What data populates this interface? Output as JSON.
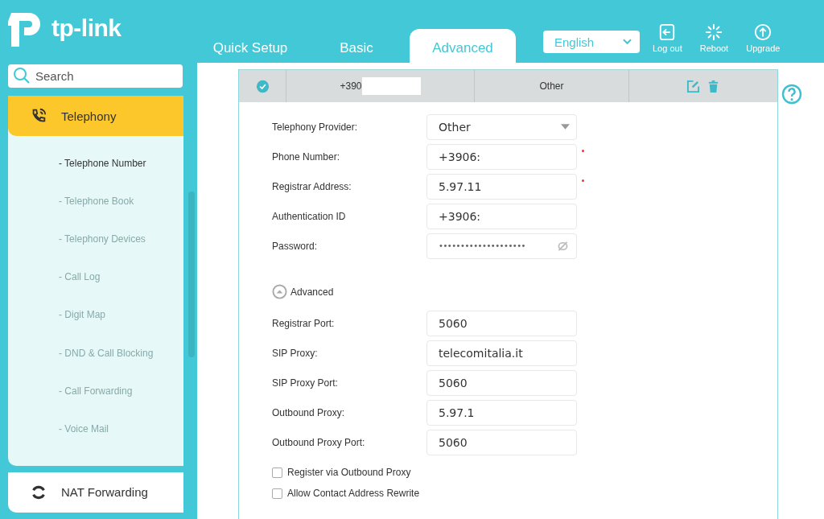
{
  "header": {
    "logo": "tp-link",
    "tabs": [
      {
        "label": "Quick Setup",
        "selected": false
      },
      {
        "label": "Basic",
        "selected": false
      },
      {
        "label": "Advanced",
        "selected": true
      }
    ],
    "language": "English",
    "actions": [
      {
        "kind": "logout",
        "label": "Log out"
      },
      {
        "kind": "reboot",
        "label": "Reboot"
      },
      {
        "kind": "upgrade",
        "label": "Upgrade"
      }
    ]
  },
  "sidebar": {
    "search": {
      "placeholder": "Search"
    },
    "items": [
      {
        "kind": "phone",
        "label": "Telephony",
        "selected": true,
        "expanded": true,
        "children": [
          {
            "label": "- Telephone Number",
            "selected": true
          },
          {
            "label": "- Telephone Book",
            "selected": false
          },
          {
            "label": "- Telephony Devices",
            "selected": false
          },
          {
            "label": "- Call Log",
            "selected": false
          },
          {
            "label": "- Digit Map",
            "selected": false
          },
          {
            "label": "- DND & Call Blocking",
            "selected": false
          },
          {
            "label": "- Call Forwarding",
            "selected": false
          },
          {
            "label": "- Voice Mail",
            "selected": false
          }
        ]
      },
      {
        "kind": "nat",
        "label": "NAT Forwarding",
        "selected": false,
        "expanded": false
      }
    ]
  },
  "table": {
    "row": {
      "checked": true,
      "number": "+390",
      "redacted": true,
      "provider": "Other"
    }
  },
  "form": {
    "fields": [
      {
        "kind": "select",
        "label": "Telephony Provider:",
        "value": "Other",
        "required": false
      },
      {
        "kind": "text",
        "label": "Phone Number:",
        "value": "+3906:",
        "required": true
      },
      {
        "kind": "text",
        "label": "Registrar Address:",
        "value": "5.97.11",
        "required": true
      },
      {
        "kind": "text",
        "label": "Authentication ID",
        "value": "+3906:",
        "required": false
      },
      {
        "kind": "password",
        "label": "Password:",
        "value": "••••••••••••••••••••",
        "required": false
      }
    ],
    "advanced": {
      "label": "Advanced",
      "expanded": true
    },
    "advanced_fields": [
      {
        "kind": "text",
        "label": "Registrar Port:",
        "value": "5060",
        "required": false
      },
      {
        "kind": "text",
        "label": "SIP Proxy:",
        "value": "telecomitalia.it",
        "required": false
      },
      {
        "kind": "text",
        "label": "SIP Proxy Port:",
        "value": "5060",
        "required": false
      },
      {
        "kind": "text",
        "label": "Outbound Proxy:",
        "value": "5.97.1",
        "required": false
      },
      {
        "kind": "text",
        "label": "Outbound Proxy Port:",
        "value": "5060",
        "required": false
      }
    ],
    "checkboxes": [
      {
        "label": "Register via Outbound Proxy",
        "checked": false
      },
      {
        "label": "Allow Contact Address Rewrite",
        "checked": false
      }
    ]
  }
}
